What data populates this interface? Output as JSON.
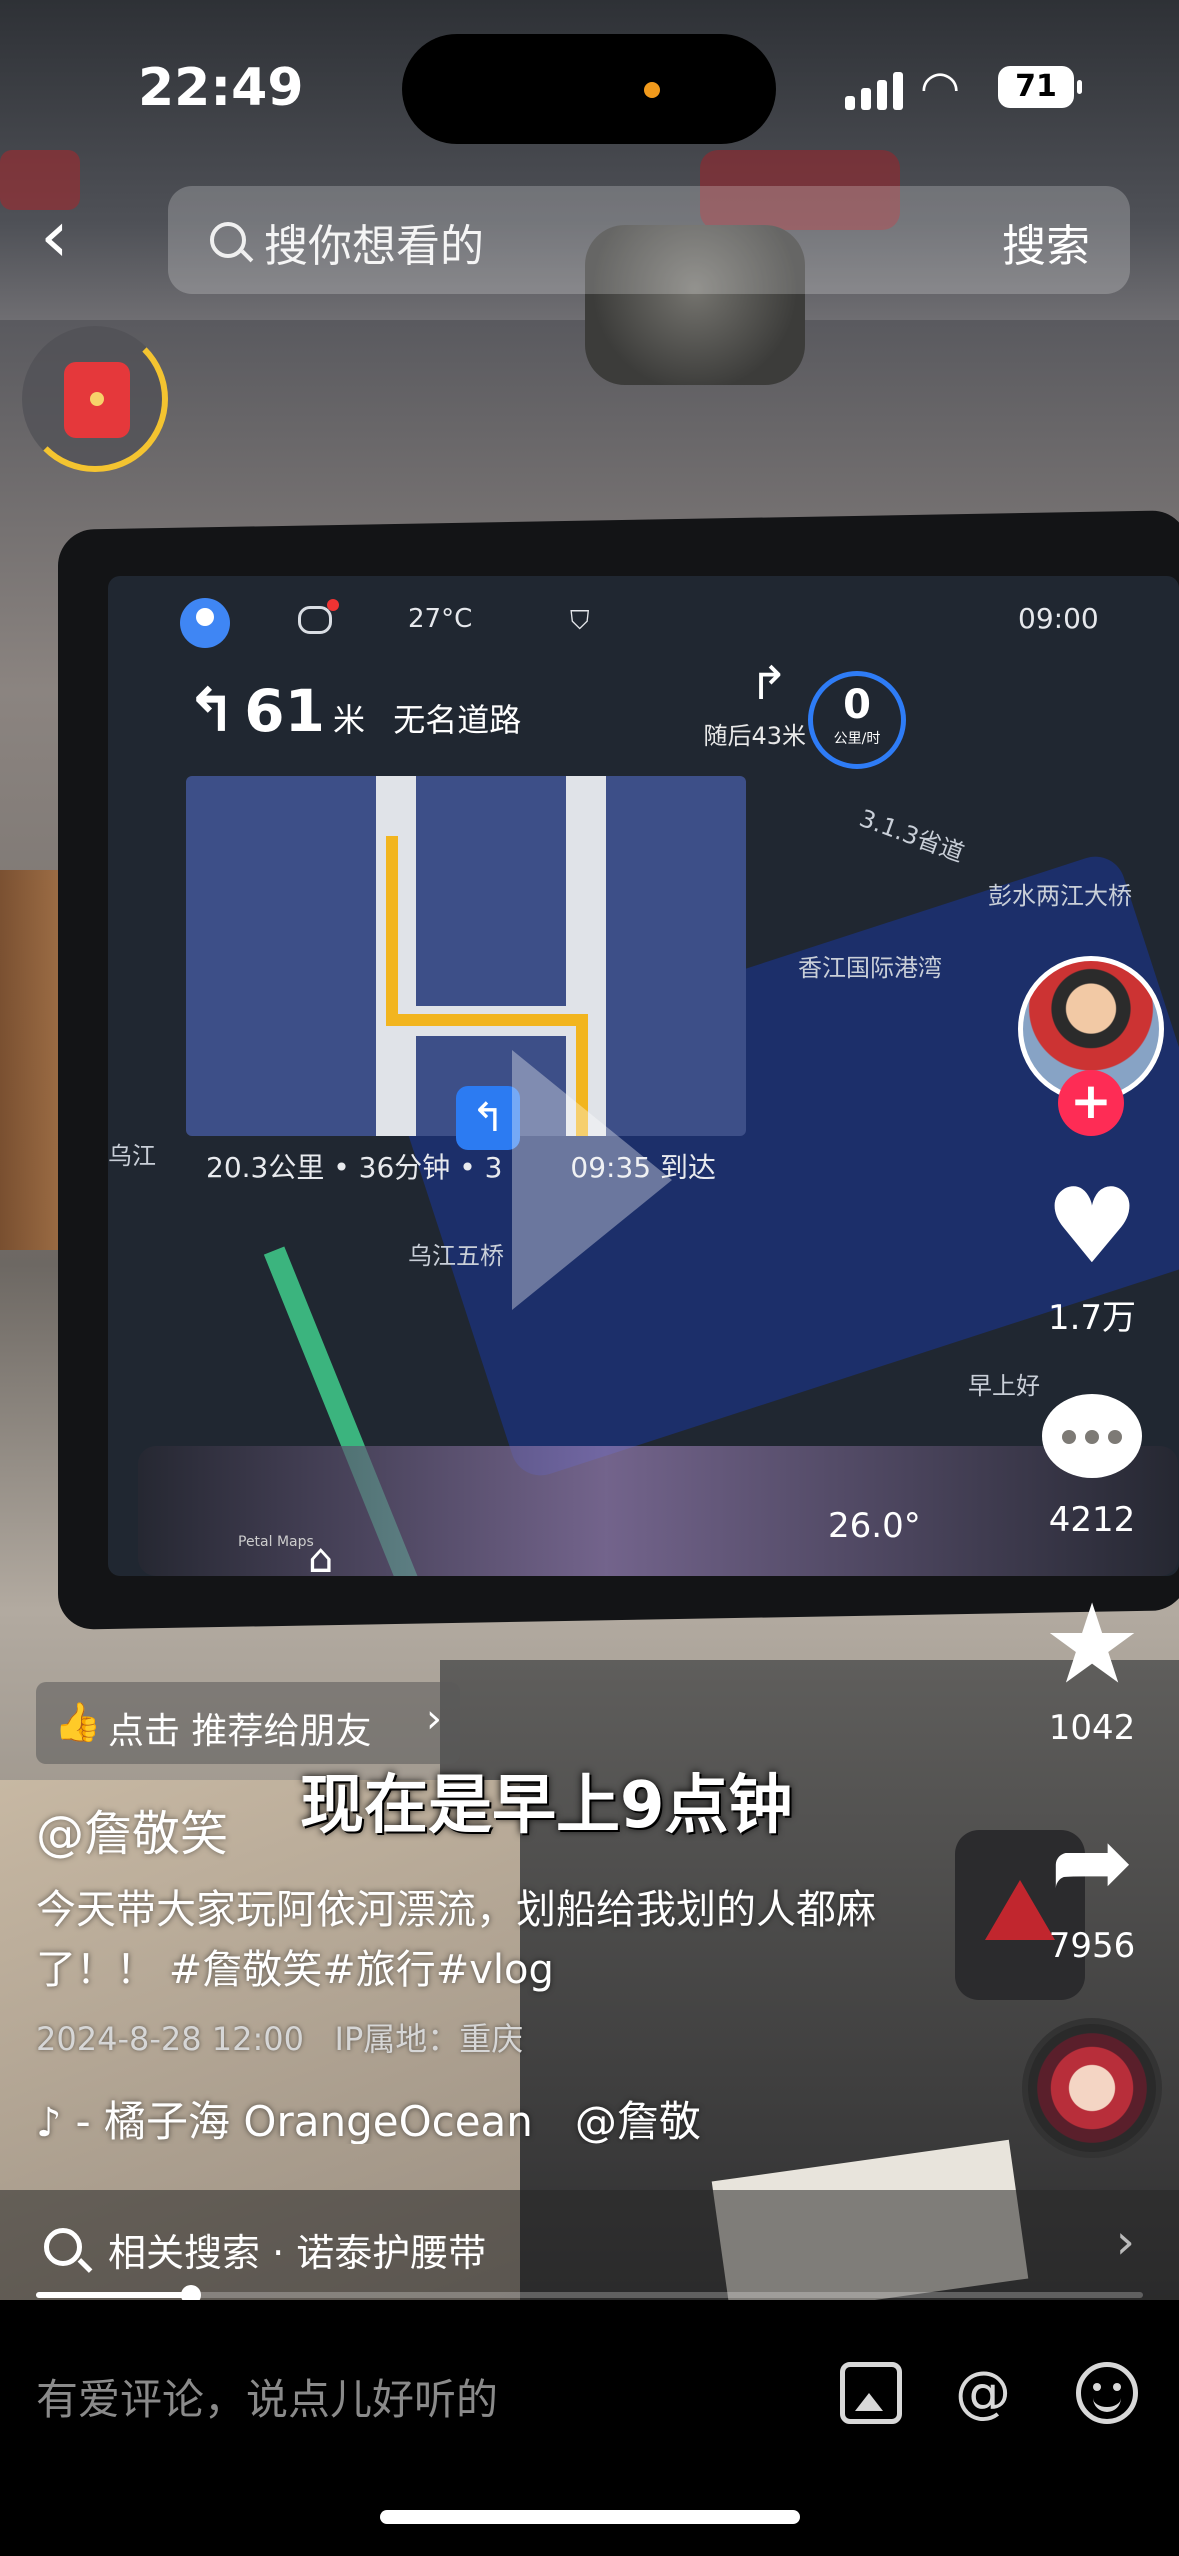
{
  "status_bar": {
    "time": "22:49",
    "battery": "71"
  },
  "search": {
    "placeholder": "搜你想看的",
    "button_label": "搜索"
  },
  "icons": {
    "back": "back-arrow-icon",
    "search": "search-icon",
    "red_packet": "red-packet-icon",
    "play": "play-icon",
    "like": "heart-icon",
    "comment": "comment-bubble-icon",
    "favorite": "star-icon",
    "share": "share-arrow-icon",
    "music": "music-note-icon",
    "thumb": "thumbs-up-icon",
    "image": "image-icon",
    "at": "at-icon",
    "emoji": "emoji-icon"
  },
  "video_screen": {
    "weather": "27°C",
    "clock": "09:00",
    "nav_distance": "61",
    "nav_unit": "米",
    "nav_road": "无名道路",
    "nav_then": "随后43米",
    "speed": "0",
    "speed_unit": "公里/时",
    "trip_summary": "20.3公里 • 36分钟 •",
    "trip_lights": "3",
    "eta": "09:35 到达",
    "map_labels": [
      "彭水两江大桥",
      "香江国际港湾",
      "乌江五桥",
      "乌江",
      "3.1.3省道",
      "早上好"
    ],
    "temperature": "26.0°",
    "app_credit": "Petal Maps"
  },
  "actions": {
    "like_count": "1.7万",
    "comment_count": "4212",
    "favorite_count": "1042",
    "share_count": "7956"
  },
  "recommend": {
    "label": "点击 推荐给朋友"
  },
  "video_caption": "现在是早上9点钟",
  "post": {
    "author": "@詹敬笑",
    "description": "今天带大家玩阿依河漂流，划船给我划的人都麻了！！ #詹敬笑#旅行#vlog",
    "date": "2024-8-28 12:00",
    "ip_location": "IP属地：重庆",
    "music": "- 橘子海 OrangeOcean　@詹敬"
  },
  "related_search": {
    "label": "相关搜索 · 诺泰护腰带"
  },
  "playback": {
    "progress": 0.14
  },
  "comment_bar": {
    "placeholder": "有爱评论，说点儿好听的",
    "at_symbol": "@"
  },
  "colors": {
    "follow_red": "#fe2c55",
    "nav_blue": "#2c7bf2",
    "route_yellow": "#f2b51f"
  }
}
